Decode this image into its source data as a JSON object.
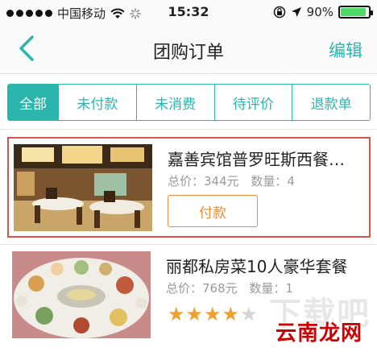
{
  "status_bar": {
    "carrier": "中国移动",
    "time": "15:32",
    "battery_percent": "90%",
    "battery_level": 0.9,
    "icons": [
      "signal-dots-icon",
      "wifi-icon",
      "loading-spinner-icon",
      "rotation-lock-icon",
      "location-arrow-icon",
      "battery-icon"
    ]
  },
  "nav": {
    "back_icon": "chevron-left-icon",
    "title": "团购订单",
    "edit_label": "编辑"
  },
  "tabs": [
    {
      "label": "全部",
      "active": true
    },
    {
      "label": "未付款",
      "active": false
    },
    {
      "label": "未消费",
      "active": false
    },
    {
      "label": "待评价",
      "active": false
    },
    {
      "label": "退款单",
      "active": false
    }
  ],
  "orders": [
    {
      "title": "嘉善宾馆普罗旺斯西餐…",
      "total_label": "总价：344元",
      "qty_label": "数量：4",
      "action_label": "付款",
      "selected": true,
      "image": "restaurant-dining-room-photo"
    },
    {
      "title": "丽都私房菜10人豪华套餐",
      "total_label": "总价：768元",
      "qty_label": "数量：1",
      "rating": 4,
      "rating_max": 5,
      "image": "banquet-table-dishes-photo"
    }
  ],
  "watermark": {
    "ghost_text": "下载吧",
    "text": "云南龙网"
  },
  "colors": {
    "accent": "#2bb5ad",
    "pay": "#f08c3a",
    "highlight": "#d9534f",
    "star": "#f0a030"
  }
}
